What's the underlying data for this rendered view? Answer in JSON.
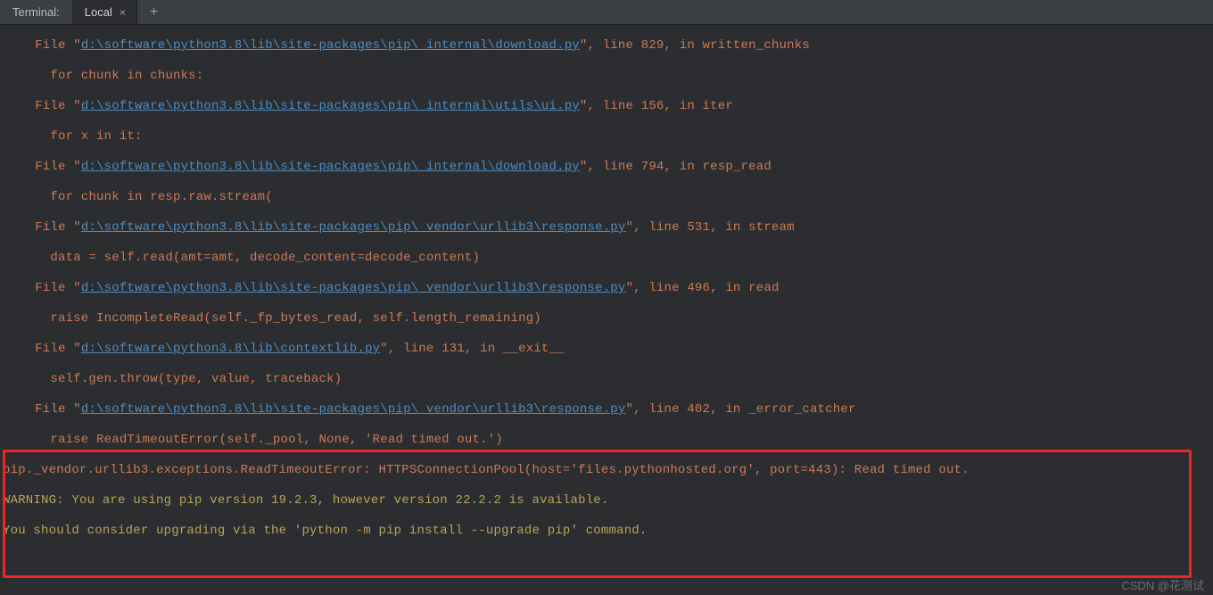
{
  "tabbar": {
    "title": "Terminal:",
    "tab_label": "Local",
    "close_glyph": "×",
    "add_glyph": "+"
  },
  "trace": [
    {
      "file_prefix": "  File \"",
      "path": "d:\\software\\python3.8\\lib\\site-packages\\pip\\_internal\\download.py",
      "file_suffix": "\", line 829, in written_chunks",
      "body": "    for chunk in chunks:"
    },
    {
      "file_prefix": "  File \"",
      "path": "d:\\software\\python3.8\\lib\\site-packages\\pip\\_internal\\utils\\ui.py",
      "file_suffix": "\", line 156, in iter",
      "body": "    for x in it:"
    },
    {
      "file_prefix": "  File \"",
      "path": "d:\\software\\python3.8\\lib\\site-packages\\pip\\_internal\\download.py",
      "file_suffix": "\", line 794, in resp_read",
      "body": "    for chunk in resp.raw.stream("
    },
    {
      "file_prefix": "  File \"",
      "path": "d:\\software\\python3.8\\lib\\site-packages\\pip\\_vendor\\urllib3\\response.py",
      "file_suffix": "\", line 531, in stream",
      "body": "    data = self.read(amt=amt, decode_content=decode_content)"
    },
    {
      "file_prefix": "  File \"",
      "path": "d:\\software\\python3.8\\lib\\site-packages\\pip\\_vendor\\urllib3\\response.py",
      "file_suffix": "\", line 496, in read",
      "body": "    raise IncompleteRead(self._fp_bytes_read, self.length_remaining)"
    },
    {
      "file_prefix": "  File \"",
      "path": "d:\\software\\python3.8\\lib\\contextlib.py",
      "file_suffix": "\", line 131, in __exit__",
      "body": "    self.gen.throw(type, value, traceback)"
    },
    {
      "file_prefix": "  File \"",
      "path": "d:\\software\\python3.8\\lib\\site-packages\\pip\\_vendor\\urllib3\\response.py",
      "file_suffix": "\", line 402, in _error_catcher",
      "body": "    raise ReadTimeoutError(self._pool, None, 'Read timed out.')"
    }
  ],
  "error_line": "pip._vendor.urllib3.exceptions.ReadTimeoutError: HTTPSConnectionPool(host='files.pythonhosted.org', port=443): Read timed out.",
  "warn1": "WARNING: You are using pip version 19.2.3, however version 22.2.2 is available.",
  "warn2": "You should consider upgrading via the 'python -m pip install --upgrade pip' command.",
  "watermark": "CSDN @花测试"
}
